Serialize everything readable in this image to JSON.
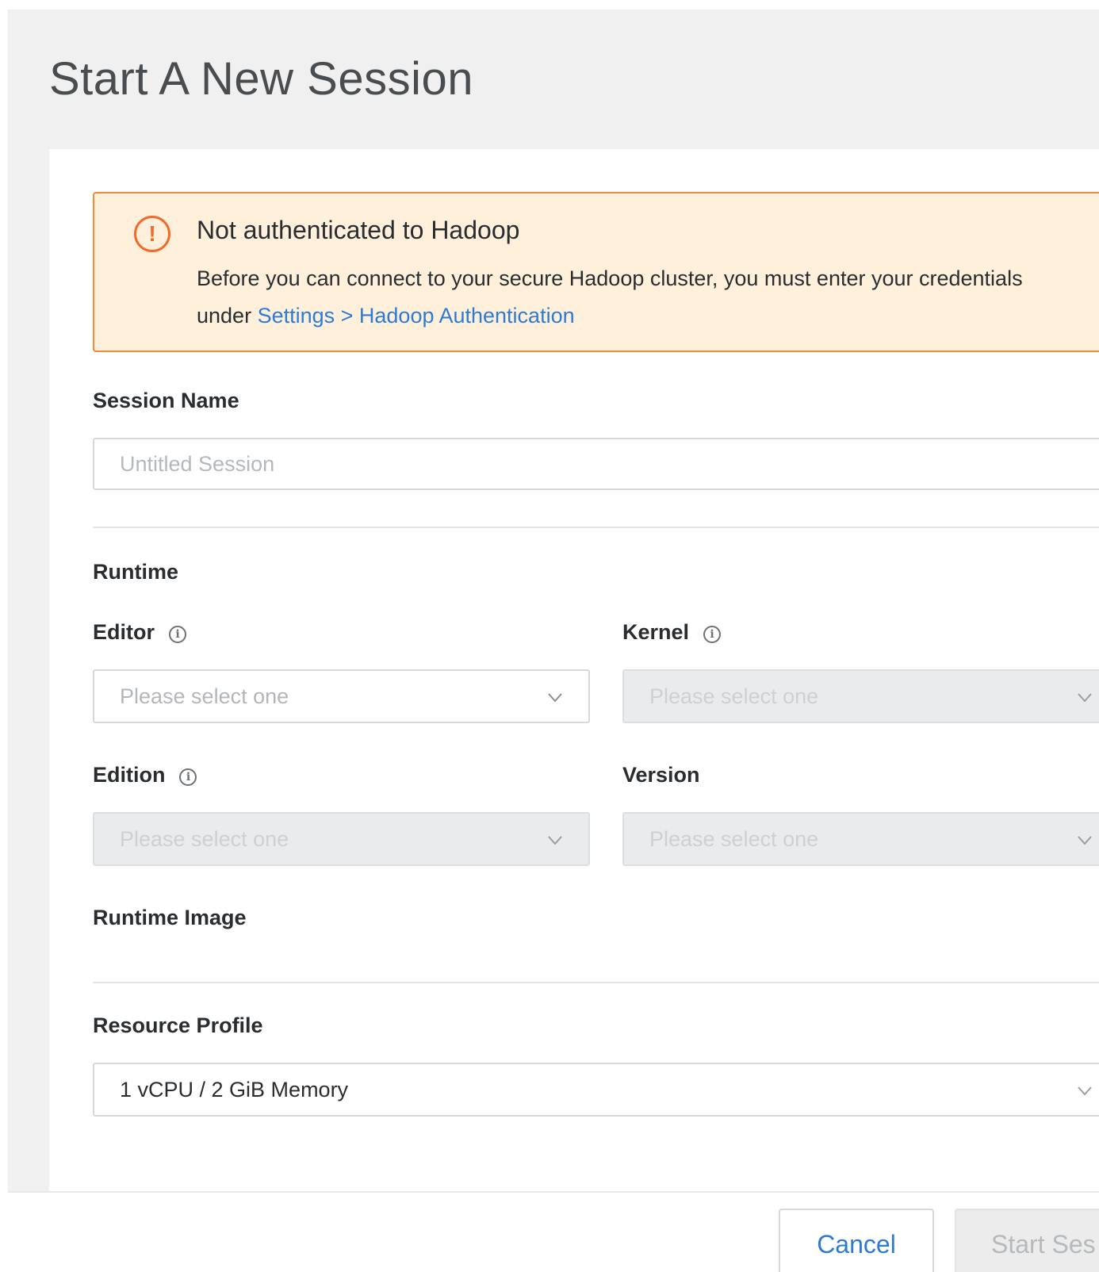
{
  "page": {
    "title": "Start A New Session"
  },
  "alert": {
    "icon": "exclamation-circle-icon",
    "title": "Not authenticated to Hadoop",
    "body": "Before you can connect to your secure Hadoop cluster, you must enter your credentials under ",
    "link_text": "Settings > Hadoop Authentication",
    "colors": {
      "background": "#fff0dc",
      "border": "#f58a3a",
      "icon": "#f2692a"
    }
  },
  "session_name": {
    "label": "Session Name",
    "value": "",
    "placeholder": "Untitled Session"
  },
  "runtime": {
    "section_label": "Runtime",
    "editor": {
      "label": "Editor",
      "placeholder": "Please select one",
      "disabled": false
    },
    "kernel": {
      "label": "Kernel",
      "placeholder": "Please select one",
      "disabled": true
    },
    "edition": {
      "label": "Edition",
      "placeholder": "Please select one",
      "disabled": true
    },
    "version": {
      "label": "Version",
      "placeholder": "Please select one",
      "disabled": true
    },
    "runtime_image_label": "Runtime Image"
  },
  "resource_profile": {
    "label": "Resource Profile",
    "selected": "1 vCPU / 2 GiB Memory"
  },
  "footer": {
    "cancel_label": "Cancel",
    "start_label": "Start Ses"
  },
  "colors": {
    "link": "#2e7bd4",
    "disabled_field": "#e9ebec"
  }
}
